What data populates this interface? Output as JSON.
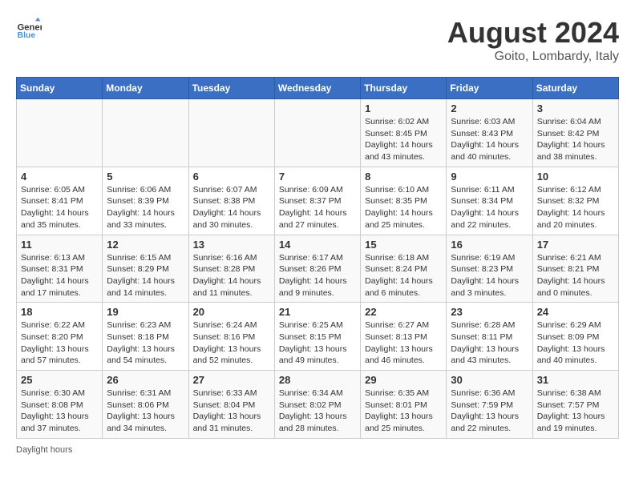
{
  "header": {
    "logo_line1": "General",
    "logo_line2": "Blue",
    "title": "August 2024",
    "subtitle": "Goito, Lombardy, Italy"
  },
  "days_of_week": [
    "Sunday",
    "Monday",
    "Tuesday",
    "Wednesday",
    "Thursday",
    "Friday",
    "Saturday"
  ],
  "weeks": [
    [
      {
        "day": "",
        "info": ""
      },
      {
        "day": "",
        "info": ""
      },
      {
        "day": "",
        "info": ""
      },
      {
        "day": "",
        "info": ""
      },
      {
        "day": "1",
        "info": "Sunrise: 6:02 AM\nSunset: 8:45 PM\nDaylight: 14 hours and 43 minutes."
      },
      {
        "day": "2",
        "info": "Sunrise: 6:03 AM\nSunset: 8:43 PM\nDaylight: 14 hours and 40 minutes."
      },
      {
        "day": "3",
        "info": "Sunrise: 6:04 AM\nSunset: 8:42 PM\nDaylight: 14 hours and 38 minutes."
      }
    ],
    [
      {
        "day": "4",
        "info": "Sunrise: 6:05 AM\nSunset: 8:41 PM\nDaylight: 14 hours and 35 minutes."
      },
      {
        "day": "5",
        "info": "Sunrise: 6:06 AM\nSunset: 8:39 PM\nDaylight: 14 hours and 33 minutes."
      },
      {
        "day": "6",
        "info": "Sunrise: 6:07 AM\nSunset: 8:38 PM\nDaylight: 14 hours and 30 minutes."
      },
      {
        "day": "7",
        "info": "Sunrise: 6:09 AM\nSunset: 8:37 PM\nDaylight: 14 hours and 27 minutes."
      },
      {
        "day": "8",
        "info": "Sunrise: 6:10 AM\nSunset: 8:35 PM\nDaylight: 14 hours and 25 minutes."
      },
      {
        "day": "9",
        "info": "Sunrise: 6:11 AM\nSunset: 8:34 PM\nDaylight: 14 hours and 22 minutes."
      },
      {
        "day": "10",
        "info": "Sunrise: 6:12 AM\nSunset: 8:32 PM\nDaylight: 14 hours and 20 minutes."
      }
    ],
    [
      {
        "day": "11",
        "info": "Sunrise: 6:13 AM\nSunset: 8:31 PM\nDaylight: 14 hours and 17 minutes."
      },
      {
        "day": "12",
        "info": "Sunrise: 6:15 AM\nSunset: 8:29 PM\nDaylight: 14 hours and 14 minutes."
      },
      {
        "day": "13",
        "info": "Sunrise: 6:16 AM\nSunset: 8:28 PM\nDaylight: 14 hours and 11 minutes."
      },
      {
        "day": "14",
        "info": "Sunrise: 6:17 AM\nSunset: 8:26 PM\nDaylight: 14 hours and 9 minutes."
      },
      {
        "day": "15",
        "info": "Sunrise: 6:18 AM\nSunset: 8:24 PM\nDaylight: 14 hours and 6 minutes."
      },
      {
        "day": "16",
        "info": "Sunrise: 6:19 AM\nSunset: 8:23 PM\nDaylight: 14 hours and 3 minutes."
      },
      {
        "day": "17",
        "info": "Sunrise: 6:21 AM\nSunset: 8:21 PM\nDaylight: 14 hours and 0 minutes."
      }
    ],
    [
      {
        "day": "18",
        "info": "Sunrise: 6:22 AM\nSunset: 8:20 PM\nDaylight: 13 hours and 57 minutes."
      },
      {
        "day": "19",
        "info": "Sunrise: 6:23 AM\nSunset: 8:18 PM\nDaylight: 13 hours and 54 minutes."
      },
      {
        "day": "20",
        "info": "Sunrise: 6:24 AM\nSunset: 8:16 PM\nDaylight: 13 hours and 52 minutes."
      },
      {
        "day": "21",
        "info": "Sunrise: 6:25 AM\nSunset: 8:15 PM\nDaylight: 13 hours and 49 minutes."
      },
      {
        "day": "22",
        "info": "Sunrise: 6:27 AM\nSunset: 8:13 PM\nDaylight: 13 hours and 46 minutes."
      },
      {
        "day": "23",
        "info": "Sunrise: 6:28 AM\nSunset: 8:11 PM\nDaylight: 13 hours and 43 minutes."
      },
      {
        "day": "24",
        "info": "Sunrise: 6:29 AM\nSunset: 8:09 PM\nDaylight: 13 hours and 40 minutes."
      }
    ],
    [
      {
        "day": "25",
        "info": "Sunrise: 6:30 AM\nSunset: 8:08 PM\nDaylight: 13 hours and 37 minutes."
      },
      {
        "day": "26",
        "info": "Sunrise: 6:31 AM\nSunset: 8:06 PM\nDaylight: 13 hours and 34 minutes."
      },
      {
        "day": "27",
        "info": "Sunrise: 6:33 AM\nSunset: 8:04 PM\nDaylight: 13 hours and 31 minutes."
      },
      {
        "day": "28",
        "info": "Sunrise: 6:34 AM\nSunset: 8:02 PM\nDaylight: 13 hours and 28 minutes."
      },
      {
        "day": "29",
        "info": "Sunrise: 6:35 AM\nSunset: 8:01 PM\nDaylight: 13 hours and 25 minutes."
      },
      {
        "day": "30",
        "info": "Sunrise: 6:36 AM\nSunset: 7:59 PM\nDaylight: 13 hours and 22 minutes."
      },
      {
        "day": "31",
        "info": "Sunrise: 6:38 AM\nSunset: 7:57 PM\nDaylight: 13 hours and 19 minutes."
      }
    ]
  ],
  "footer": "Daylight hours"
}
